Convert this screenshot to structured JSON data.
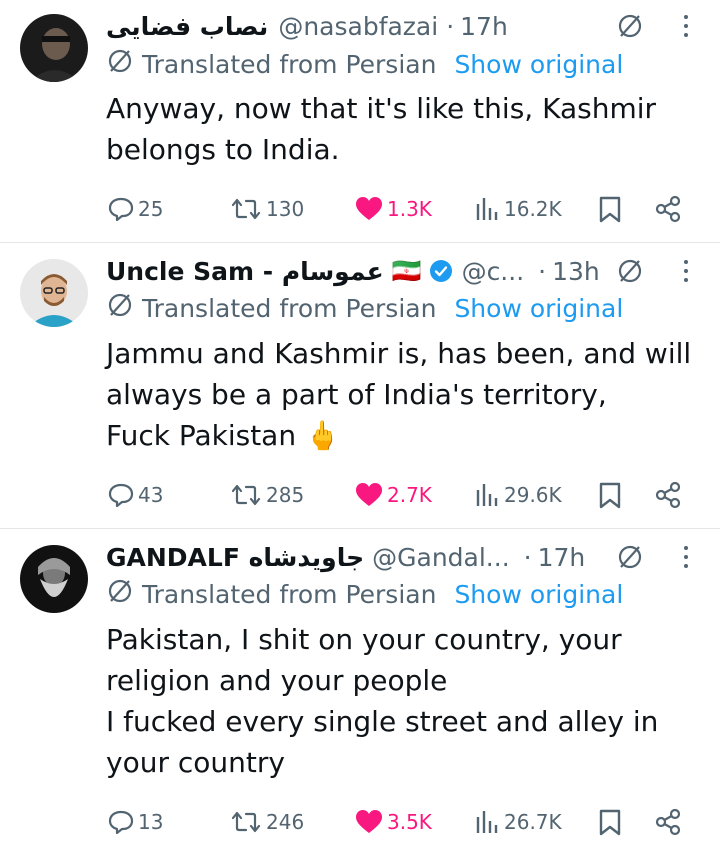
{
  "translate_label": "Translated from Persian",
  "show_original": "Show original",
  "colors": {
    "like": "#f91880",
    "link": "#1d9bf0",
    "muted": "#536471",
    "verified": "#1d9bf0"
  },
  "tweets": [
    {
      "name": "نصاب فضایی",
      "handle": "@nasabfazai",
      "time": "17h",
      "lines": [
        "Anyway, now that it's like this, Kashmir",
        "belongs to India."
      ],
      "replies": "25",
      "reposts": "130",
      "likes": "1.3K",
      "views": "16.2K"
    },
    {
      "name": "Uncle Sam - عموسام",
      "flag": "🇮🇷",
      "verified": true,
      "handle": "@c...",
      "time": "13h",
      "lines": [
        "Jammu and Kashmir is, has been, and will",
        "always be a part of India's territory,",
        "Fuck Pakistan 🖕"
      ],
      "replies": "43",
      "reposts": "285",
      "likes": "2.7K",
      "views": "29.6K"
    },
    {
      "name": "GANDALF جاویدشاه",
      "handle": "@Gandal...",
      "time": "17h",
      "lines": [
        "Pakistan, I shit on your country, your",
        "religion and your people",
        "I fucked every single street and alley in",
        "your country"
      ],
      "replies": "13",
      "reposts": "246",
      "likes": "3.5K",
      "views": "26.7K"
    }
  ]
}
